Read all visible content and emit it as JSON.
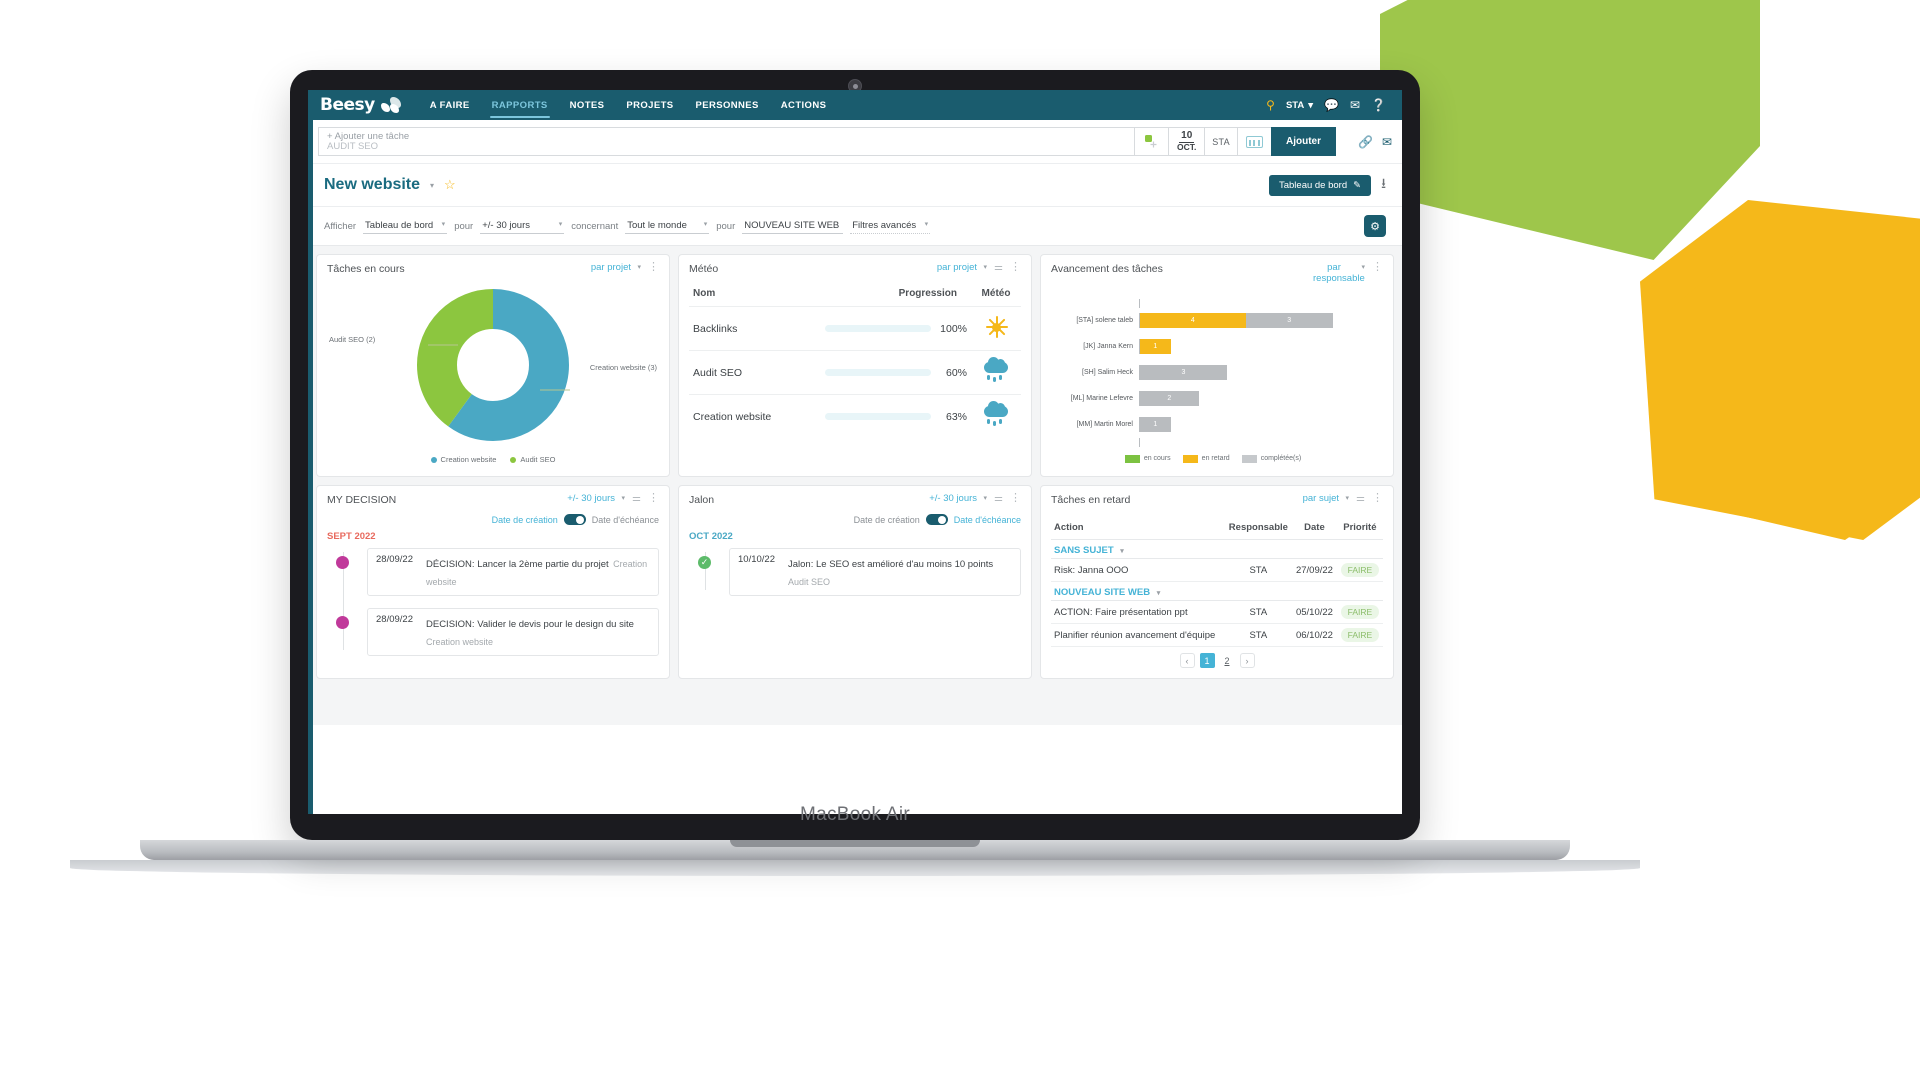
{
  "device": {
    "label": "MacBook Air"
  },
  "navbar": {
    "brand": "Beesy",
    "links": [
      {
        "label": "A FAIRE",
        "active": false
      },
      {
        "label": "RAPPORTS",
        "active": true
      },
      {
        "label": "NOTES",
        "active": false
      },
      {
        "label": "PROJETS",
        "active": false
      },
      {
        "label": "PERSONNES",
        "active": false
      },
      {
        "label": "ACTIONS",
        "active": false
      }
    ],
    "user": "STA",
    "user_caret": "▾",
    "icons": [
      "pin-icon",
      "chat-icon",
      "mail-icon",
      "help-icon"
    ]
  },
  "add_task": {
    "placeholder": "+ Ajouter une tâche",
    "value": "AUDIT SEO",
    "tag_icon": "add-tag-icon",
    "date_day": "10",
    "date_month": "OCT.",
    "assignee": "STA",
    "keyboard_icon": "keyboard-icon",
    "button": "Ajouter",
    "right_icons": [
      "link-icon",
      "upload-icon"
    ]
  },
  "title_row": {
    "project": "New website",
    "caret": "▾",
    "star_icon": "star-icon",
    "dashboard_button": "Tableau de bord",
    "edit_icon": "pencil-icon",
    "download_icon": "download-icon"
  },
  "filters": {
    "afficher_label": "Afficher",
    "afficher_value": "Tableau de bord",
    "pour_label_1": "pour",
    "period_value": "+/- 30 jours",
    "concernant_label": "concernant",
    "who_value": "Tout le monde",
    "pour_label_2": "pour",
    "scope_value": "NOUVEAU SITE WEB",
    "advanced_value": "Filtres avancés",
    "gear_icon": "gear-icon"
  },
  "widgets": {
    "tasks_in_progress": {
      "title": "Tâches en cours",
      "group_by": "par projet",
      "dots_icon": "more-options-icon"
    },
    "weather": {
      "title": "Météo",
      "group_by": "par projet",
      "filter_icon": "filter-icon",
      "dots_icon": "more-options-icon",
      "columns": [
        "Nom",
        "Progression",
        "Météo"
      ],
      "rows": [
        {
          "name": "Backlinks",
          "progress": 100,
          "pct": "100%",
          "weather": "sun"
        },
        {
          "name": "Audit SEO",
          "progress": 60,
          "pct": "60%",
          "weather": "rain"
        },
        {
          "name": "Creation website",
          "progress": 63,
          "pct": "63%",
          "weather": "rain"
        }
      ]
    },
    "task_advancement": {
      "title": "Avancement des tâches",
      "group_by": "par responsable",
      "dots_icon": "more-options-icon"
    },
    "my_decision": {
      "title": "MY DECISION",
      "period": "+/- 30 jours",
      "filter_icon": "filter-icon",
      "dots_icon": "more-options-icon",
      "toggle_left": "Date de création",
      "toggle_right": "Date d'échéance",
      "month": "SEPT 2022",
      "items": [
        {
          "date": "28/09/22",
          "text": "DÉCISION: Lancer la 2ème partie du projet",
          "sub": "Creation website",
          "bullet": "dot"
        },
        {
          "date": "28/09/22",
          "text": "DECISION: Valider le devis pour le design du site",
          "sub": "Creation website",
          "bullet": "dot"
        }
      ]
    },
    "jalon": {
      "title": "Jalon",
      "period": "+/- 30 jours",
      "filter_icon": "filter-icon",
      "dots_icon": "more-options-icon",
      "toggle_left": "Date de création",
      "toggle_right": "Date d'échéance",
      "month": "OCT 2022",
      "items": [
        {
          "date": "10/10/22",
          "text": "Jalon: Le SEO est amélioré d'au moins 10 points",
          "sub": "Audit SEO",
          "bullet": "check"
        }
      ]
    },
    "late_tasks": {
      "title": "Tâches en retard",
      "group_by": "par sujet",
      "filter_icon": "filter-icon",
      "dots_icon": "more-options-icon",
      "columns": [
        "Action",
        "Responsable",
        "Date",
        "Priorité"
      ],
      "groups": [
        {
          "name": "SANS SUJET",
          "rows": [
            {
              "action": "Risk: Janna OOO",
              "responsable": "STA",
              "date": "27/09/22",
              "priority": "FAIRE"
            }
          ]
        },
        {
          "name": "NOUVEAU SITE WEB",
          "rows": [
            {
              "action": "ACTION: Faire présentation ppt",
              "responsable": "STA",
              "date": "05/10/22",
              "priority": "FAIRE"
            },
            {
              "action": "Planifier réunion avancement d'équipe",
              "responsable": "STA",
              "date": "06/10/22",
              "priority": "FAIRE"
            }
          ]
        }
      ],
      "pagination": {
        "prev": "‹",
        "pages": [
          "1",
          "2"
        ],
        "current": "1",
        "next": "›"
      }
    }
  },
  "colors": {
    "brand_teal": "#1a5c6e",
    "accent_blue": "#45b3d6",
    "green": "#7cc241",
    "orange": "#f5b81a",
    "grey": "#b9bcbf",
    "red": "#e86a5e",
    "magenta": "#c0399a"
  },
  "chart_data": [
    {
      "type": "pie",
      "title": "Tâches en cours",
      "labels": [
        "Creation website",
        "Audit SEO"
      ],
      "values": [
        3,
        2
      ],
      "value_labels": [
        "Creation website (3)",
        "Audit SEO  (2)"
      ],
      "colors": [
        "#4aa8c4",
        "#7cc241"
      ],
      "legend": [
        "Creation website",
        "Audit SEO"
      ],
      "legend_position": "bottom",
      "donut": true
    },
    {
      "type": "bar",
      "title": "Avancement des tâches",
      "orientation": "horizontal",
      "stacked": true,
      "categories": [
        "[STA] solene taleb",
        "[JK] Janna Kern",
        "[SH] Salim  Heck",
        "[ML] Marine Lefevre",
        "[MM] Martin Morel"
      ],
      "series": [
        {
          "name": "en cours",
          "color": "#7cc241",
          "values": [
            0,
            0,
            0,
            0,
            0
          ]
        },
        {
          "name": "en retard",
          "color": "#f5b81a",
          "values": [
            4,
            1,
            0,
            0,
            0
          ]
        },
        {
          "name": "complétée(s)",
          "color": "#b9bcbf",
          "values": [
            3,
            0,
            3,
            2,
            1
          ]
        }
      ],
      "xlim": [
        0,
        7
      ],
      "grid": false,
      "legend": [
        "en cours",
        "en retard",
        "complétée(s)"
      ],
      "legend_position": "bottom"
    },
    {
      "type": "bar",
      "title": "Météo - Progression",
      "orientation": "horizontal",
      "categories": [
        "Backlinks",
        "Audit SEO",
        "Creation website"
      ],
      "values": [
        100,
        60,
        63
      ],
      "ylabel": "Progression",
      "xlim": [
        0,
        100
      ],
      "grid": false
    }
  ]
}
